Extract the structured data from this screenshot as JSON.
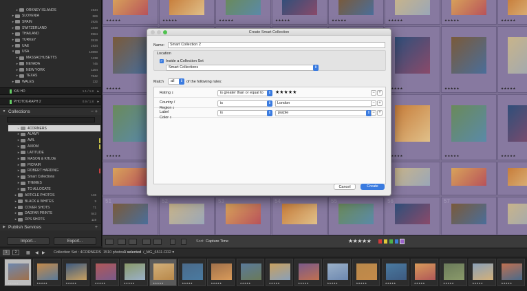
{
  "left_panel": {
    "folders": [
      {
        "label": "ORKNEY ISLANDS",
        "count": "1944",
        "indent": 2,
        "twisty": "▸"
      },
      {
        "label": "SLOVENIA",
        "count": "869",
        "indent": 1,
        "twisty": "▸"
      },
      {
        "label": "SPAIN",
        "count": "2925",
        "indent": 1,
        "twisty": "▸"
      },
      {
        "label": "SWITZERLAND",
        "count": "1848",
        "indent": 1,
        "twisty": "▸"
      },
      {
        "label": "THAILAND",
        "count": "9964",
        "indent": 1,
        "twisty": "▸"
      },
      {
        "label": "TURKEY",
        "count": "3519",
        "indent": 1,
        "twisty": "▸"
      },
      {
        "label": "UAE",
        "count": "1934",
        "indent": 1,
        "twisty": "▸"
      },
      {
        "label": "USA",
        "count": "10890",
        "indent": 1,
        "twisty": "▾"
      },
      {
        "label": "MASSACHUSETTS",
        "count": "1138",
        "indent": 2,
        "twisty": "▸"
      },
      {
        "label": "NEVADA",
        "count": "745",
        "indent": 2,
        "twisty": "▸"
      },
      {
        "label": "NEW YORK",
        "count": "1164",
        "indent": 2,
        "twisty": "▸"
      },
      {
        "label": "TEXAS",
        "count": "7842",
        "indent": 2,
        "twisty": "▸"
      },
      {
        "label": "WALES",
        "count": "132",
        "indent": 1,
        "twisty": "▸"
      }
    ],
    "volumes": [
      {
        "label": "KAI HD",
        "size": "1.1 / 1.8",
        "twisty": "▸"
      },
      {
        "label": "PHOTOGRAPH 2",
        "size": "0.9 / 1.8",
        "twisty": "▸"
      }
    ],
    "collections_header": "Collections",
    "collections": [
      {
        "label": "4CORNERS",
        "count": "",
        "indent": 1,
        "selected": true
      },
      {
        "label": "ALAMY",
        "count": "",
        "indent": 1
      },
      {
        "label": "AWL",
        "count": "",
        "indent": 1
      },
      {
        "label": "AXIOM",
        "count": "",
        "indent": 1
      },
      {
        "label": "LATITUDE",
        "count": "",
        "indent": 1
      },
      {
        "label": "MASON & KHLOE",
        "count": "",
        "indent": 1
      },
      {
        "label": "PICFAIR",
        "count": "",
        "indent": 1
      },
      {
        "label": "ROBERT HARDING",
        "count": "",
        "indent": 1
      },
      {
        "label": "Smart Collections",
        "count": "",
        "indent": 1
      },
      {
        "label": "THEMES",
        "count": "",
        "indent": 1
      },
      {
        "label": "TO ALLOCATE",
        "count": "",
        "indent": 1
      },
      {
        "label": "ARTICLE PHOTOS",
        "count": "136",
        "indent": 0
      },
      {
        "label": "BLACK & WHITES",
        "count": "9",
        "indent": 0
      },
      {
        "label": "COVER SHOTS",
        "count": "71",
        "indent": 0
      },
      {
        "label": "DADFAR PRINTS",
        "count": "543",
        "indent": 0
      },
      {
        "label": "DPS SHOTS",
        "count": "119",
        "indent": 0
      }
    ],
    "publish_header": "Publish Services",
    "import_label": "Import...",
    "export_label": "Export..."
  },
  "grid": {
    "cell_numbers": [
      "",
      "",
      "",
      "",
      "",
      "",
      "",
      "",
      "",
      "",
      "",
      "",
      "",
      "",
      "",
      "",
      "",
      "",
      "",
      "",
      "",
      "",
      "",
      "",
      "",
      "",
      "",
      "",
      "",
      "",
      "",
      "",
      "",
      "",
      "",
      "",
      "",
      "",
      "",
      "",
      "",
      "",
      "",
      "",
      "",
      "",
      "",
      "",
      "",
      "",
      "51",
      "52",
      "53",
      "54",
      "55",
      "56",
      "57"
    ],
    "rating_glyph": "★★★★★"
  },
  "toolbar": {
    "sort_label": "Sort:",
    "sort_value": "Capture Time",
    "stars": "★★★★★"
  },
  "status": {
    "screen1": "1",
    "screen2": "2",
    "breadcrumb": "Collection Set : 4CORNERS",
    "photos": "1510 photos /",
    "selected": "1 selected",
    "filename": "/_MG_6511.CR2 ▾"
  },
  "dialog": {
    "title": "Create Smart Collection",
    "name_label": "Name:",
    "name_value": "Smart Collection 2",
    "location_label": "Location",
    "inside_set_label": "Inside a Collection Set",
    "inside_set_checked": true,
    "set_value": "Smart Collections",
    "match_label": "Match",
    "match_value": "all",
    "following_rules": "of the following rules:",
    "rules": [
      {
        "field": "Rating",
        "op": "is greater than or equal to",
        "value": "★★★★★",
        "value_kind": "stars"
      },
      {
        "field": "Country / Region",
        "op": "is",
        "value": "London",
        "value_kind": "text"
      },
      {
        "field": "Label Color",
        "op": "is",
        "value": "purple",
        "value_kind": "select"
      }
    ],
    "cancel_label": "Cancel",
    "create_label": "Create"
  }
}
